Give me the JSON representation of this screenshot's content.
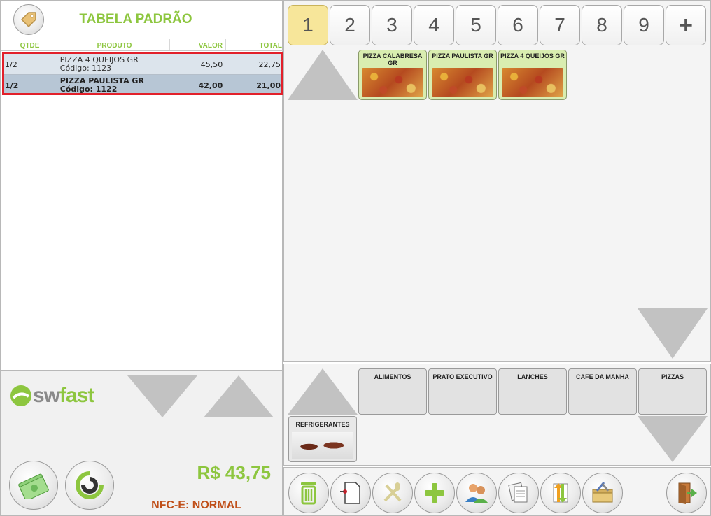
{
  "left": {
    "title": "TABELA PADRÃO",
    "columns": [
      "QTDE",
      "PRODUTO",
      "VALOR",
      "TOTAL"
    ],
    "items": [
      {
        "qty": "1/2",
        "name": "PIZZA 4 QUEIJOS GR",
        "code": "Código: 1123",
        "value": "45,50",
        "total": "22,75"
      },
      {
        "qty": "1/2",
        "name": "PIZZA PAULISTA GR",
        "code": "Código: 1122",
        "value": "42,00",
        "total": "21,00"
      }
    ],
    "logo_sw": "sw",
    "logo_fast": "fast",
    "total": "R$ 43,75",
    "nfce": "NFC-E: NORMAL"
  },
  "tabs": [
    "1",
    "2",
    "3",
    "4",
    "5",
    "6",
    "7",
    "8",
    "9",
    "+"
  ],
  "products": [
    "PIZZA CALABRESA GR",
    "PIZZA PAULISTA GR",
    "PIZZA 4 QUEIJOS GR"
  ],
  "categories": [
    "ALIMENTOS",
    "PRATO EXECUTIVO",
    "LANCHES",
    "CAFE DA MANHA",
    "PIZZAS",
    "REFRIGERANTES"
  ],
  "colors": {
    "accent": "#8dc63f",
    "highlight": "#e2202a",
    "nfce": "#c0501a",
    "active_tab": "#f7e69a"
  }
}
